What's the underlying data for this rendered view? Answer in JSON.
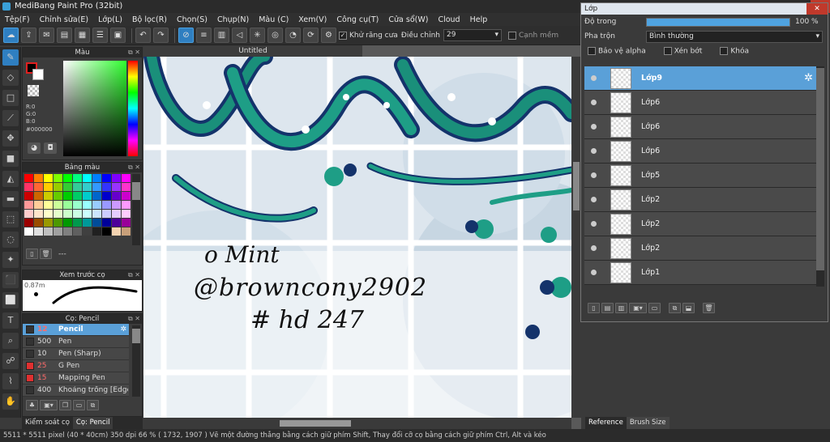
{
  "title": "MediBang Paint Pro (32bit)",
  "menu": [
    "Tệp(F)",
    "Chỉnh sửa(E)",
    "Lớp(L)",
    "Bộ lọc(R)",
    "Chọn(S)",
    "Chụp(N)",
    "Màu (C)",
    "Xem(V)",
    "Công cụ(T)",
    "Cửa sổ(W)",
    "Cloud",
    "Help"
  ],
  "toolbar": {
    "antialias": "Khử răng cưa",
    "adjust": "Điều chỉnh",
    "adjust_value": "29",
    "sharp_edge": "Cạnh mềm"
  },
  "color_panel": {
    "title": "Màu",
    "r": "R:0",
    "g": "G:0",
    "b": "B:0",
    "hex": "#000000"
  },
  "swatch_panel": {
    "title": "Bảng màu",
    "more": "---"
  },
  "brush_preview": {
    "title": "Xem trước cọ",
    "size": "0.87m"
  },
  "brush_panel": {
    "title": "Cọ: Pencil",
    "items": [
      {
        "size": "12",
        "name": "Pencil",
        "color": "#333333"
      },
      {
        "size": "500",
        "name": "Pen",
        "color": "#333333"
      },
      {
        "size": "10",
        "name": "Pen (Sharp)",
        "color": "#333333"
      },
      {
        "size": "25",
        "name": "G Pen",
        "color": "#e03030"
      },
      {
        "size": "15",
        "name": "Mapping Pen",
        "color": "#e03030"
      },
      {
        "size": "400",
        "name": "Khoảng trống [Edge B",
        "color": "#333333"
      }
    ]
  },
  "bottom_tabs": {
    "control": "Kiểm soát cọ",
    "brush": "Cọ: Pencil"
  },
  "document": {
    "tab": "Untitled"
  },
  "canvas_text": {
    "line1": "o Mint",
    "line2": "@browncony2902",
    "line3": "# hd 247"
  },
  "status": {
    "text": "5511 * 5511 pixel  (40 * 40cm)  350 dpi  66 %  ( 1732, 1907 )  Vẽ một đường thẳng bằng cách giữ phím Shift, Thay đổi cỡ cọ bằng cách giữ phím Ctrl, Alt và kéo"
  },
  "layer_window": {
    "title": "Lớp",
    "opacity_label": "Độ trong",
    "opacity_value": "100 %",
    "blend_label": "Pha trộn",
    "blend_value": "Bình thường",
    "protect_alpha": "Bảo vệ alpha",
    "clipping": "Xén bớt",
    "lock": "Khóa",
    "layers": [
      "Lớp9",
      "Lớp6",
      "Lớp6",
      "Lớp6",
      "Lớp5",
      "Lớp2",
      "Lớp2",
      "Lớp2",
      "Lớp1"
    ],
    "tabs": {
      "reference": "Reference",
      "brush_size": "Brush Size"
    }
  },
  "icons": [
    "brush-icon",
    "eraser-icon",
    "rect-icon",
    "pen-icon",
    "move-icon",
    "fill-icon",
    "gradient-icon",
    "select-icon",
    "lasso-icon",
    "magic-wand-icon",
    "text-icon",
    "hand-icon",
    "eyedropper-icon"
  ],
  "colors": {
    "accent": "#2f7fc1",
    "selected_row": "#5aa0d8"
  }
}
